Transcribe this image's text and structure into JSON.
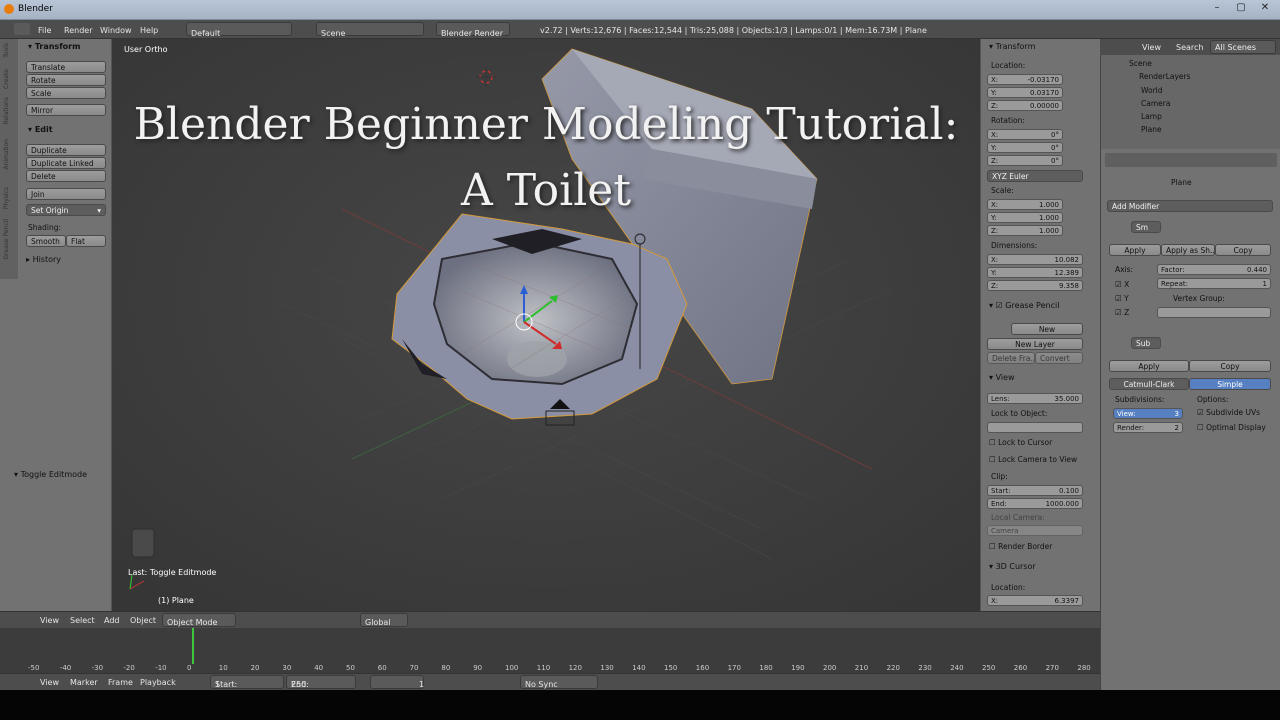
{
  "window": {
    "title": "Blender"
  },
  "menu": {
    "items": [
      "File",
      "Render",
      "Window",
      "Help"
    ],
    "layout": "Default",
    "scene": "Scene",
    "engine": "Blender Render",
    "stats": "v2.72 | Verts:12,676 | Faces:12,544 | Tris:25,088 | Objects:1/3 | Lamps:0/1 | Mem:16.73M | Plane"
  },
  "toolshelf": {
    "transform_header": "Transform",
    "translate": "Translate",
    "rotate": "Rotate",
    "scale": "Scale",
    "mirror": "Mirror",
    "edit_header": "Edit",
    "duplicate": "Duplicate",
    "duplicate_linked": "Duplicate Linked",
    "delete": "Delete",
    "join": "Join",
    "set_origin": "Set Origin",
    "shading": "Shading:",
    "smooth": "Smooth",
    "flat": "Flat",
    "history": "History",
    "toggle_editmode": "Toggle Editmode",
    "tabs": [
      "Tools",
      "Create",
      "Relations",
      "Animation",
      "Physics",
      "Grease Pencil"
    ]
  },
  "viewport": {
    "view_label": "User Ortho",
    "title_line1": "Blender Beginner Modeling Tutorial:",
    "title_line2": "A Toilet",
    "last_op": "Last: Toggle Editmode",
    "object_label": "(1) Plane"
  },
  "vpheader": {
    "view": "View",
    "select": "Select",
    "add": "Add",
    "object": "Object",
    "mode": "Object Mode",
    "orientation": "Global"
  },
  "npanel": {
    "transform": "Transform",
    "location": "Location:",
    "loc": [
      {
        "k": "X:",
        "v": "-0.03170"
      },
      {
        "k": "Y:",
        "v": "0.03170"
      },
      {
        "k": "Z:",
        "v": "0.00000"
      }
    ],
    "rotation": "Rotation:",
    "rot": [
      {
        "k": "X:",
        "v": "0°"
      },
      {
        "k": "Y:",
        "v": "0°"
      },
      {
        "k": "Z:",
        "v": "0°"
      }
    ],
    "euler": "XYZ Euler",
    "scale": "Scale:",
    "scl": [
      {
        "k": "X:",
        "v": "1.000"
      },
      {
        "k": "Y:",
        "v": "1.000"
      },
      {
        "k": "Z:",
        "v": "1.000"
      }
    ],
    "dimensions": "Dimensions:",
    "dim": [
      {
        "k": "X:",
        "v": "10.082"
      },
      {
        "k": "Y:",
        "v": "12.389"
      },
      {
        "k": "Z:",
        "v": "9.358"
      }
    ],
    "grease": "Grease Pencil",
    "new": "New",
    "new_layer": "New Layer",
    "delete_frame": "Delete Fra...",
    "convert": "Convert",
    "view": "View",
    "lens_k": "Lens:",
    "lens_v": "35.000",
    "lock_obj": "Lock to Object:",
    "lock_cursor": "Lock to Cursor",
    "lock_cam": "Lock Camera to View",
    "clip": "Clip:",
    "start_k": "Start:",
    "start_v": "0.100",
    "end_k": "End:",
    "end_v": "1000.000",
    "local_cam": "Local Camera:",
    "camera": "Camera",
    "render_border": "Render Border",
    "cursor3d": "3D Cursor",
    "cursor_loc": "Location:",
    "cx_k": "X:",
    "cx_v": "6.3397"
  },
  "outliner": {
    "view": "View",
    "search": "Search",
    "all_scenes": "All Scenes",
    "items": [
      "Scene",
      "RenderLayers",
      "World",
      "Camera",
      "Lamp",
      "Plane"
    ]
  },
  "props": {
    "object": "Plane",
    "add_modifier": "Add Modifier",
    "mod1": {
      "name": "Sm",
      "apply": "Apply",
      "apply_shape": "Apply as Sh...",
      "copy": "Copy",
      "axis": "Axis:",
      "factor_k": "Factor:",
      "factor_v": "0.440",
      "repeat_k": "Repeat:",
      "repeat_v": "1",
      "vgroup": "Vertex Group:",
      "x": "X",
      "y": "Y",
      "z": "Z"
    },
    "mod2": {
      "name": "Sub",
      "apply": "Apply",
      "copy": "Copy",
      "catmull": "Catmull-Clark",
      "simple": "Simple",
      "subdivisions": "Subdivisions:",
      "options": "Options:",
      "view_k": "View:",
      "view_v": "3",
      "render_k": "Render:",
      "render_v": "2",
      "subdivide_uvs": "Subdivide UVs",
      "optimal": "Optimal Display"
    }
  },
  "timeline": {
    "ticks": [
      "-50",
      "-40",
      "-30",
      "-20",
      "-10",
      "0",
      "10",
      "20",
      "30",
      "40",
      "50",
      "60",
      "70",
      "80",
      "90",
      "100",
      "110",
      "120",
      "130",
      "140",
      "150",
      "160",
      "170",
      "180",
      "190",
      "200",
      "210",
      "220",
      "230",
      "240",
      "250",
      "260",
      "270",
      "280"
    ],
    "view": "View",
    "marker": "Marker",
    "frame": "Frame",
    "playback": "Playback",
    "start_k": "Start:",
    "start_v": "1",
    "end_k": "End:",
    "end_v": "250",
    "current": "1",
    "sync": "No Sync"
  }
}
